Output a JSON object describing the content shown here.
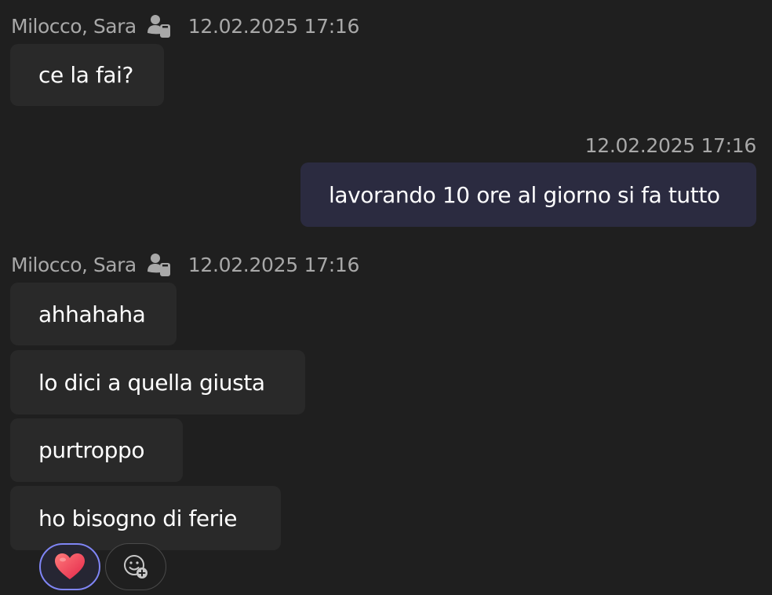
{
  "messages": {
    "group1": {
      "sender": "Milocco, Sara",
      "timestamp": "12.02.2025 17:16",
      "bubbles": [
        "ce la fai?"
      ]
    },
    "self_msg": {
      "timestamp": "12.02.2025 17:16",
      "text": "lavorando 10 ore al giorno si fa tutto"
    },
    "group2": {
      "sender": "Milocco, Sara",
      "timestamp": "12.02.2025 17:16",
      "bubbles": [
        "ahhahaha",
        "lo dici a quella giusta",
        "purtroppo",
        "ho bisogno di ferie"
      ]
    }
  },
  "reactions": {
    "existing": {
      "icon": "heart-icon"
    },
    "add": {
      "icon": "add-reaction-icon"
    }
  },
  "colors": {
    "background": "#1f1f1f",
    "incoming_bubble": "#292929",
    "outgoing_bubble": "#2b2b40",
    "accent": "#7f85f5",
    "meta_text": "#a8a8a8"
  }
}
